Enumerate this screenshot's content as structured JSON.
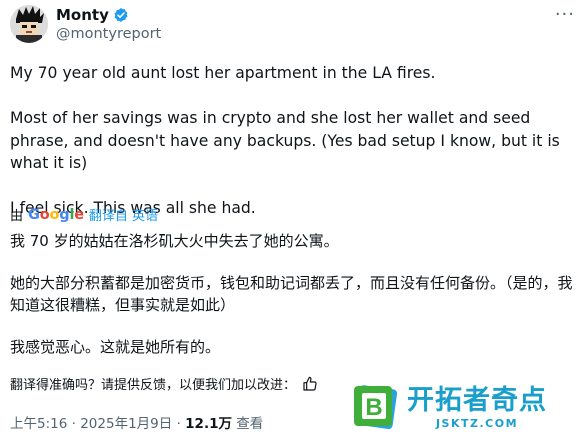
{
  "author": {
    "name": "Monty",
    "handle": "@montyreport",
    "verified": true,
    "avatar_icon": "pixel-art-avatar-icon"
  },
  "more_menu": "···",
  "tweet": {
    "paragraphs": [
      "My 70 year old aunt lost her apartment in the LA fires.",
      "Most of her savings was in crypto and she lost her wallet and seed phrase, and doesn't have any backups. (Yes bad setup I know, but it is what it is)",
      "I feel sick. This was all she had."
    ]
  },
  "translation": {
    "by_label": "由",
    "provider": "Google",
    "link_label": "翻译自 英语",
    "paragraphs": [
      "我 70 岁的姑姑在洛杉矶大火中失去了她的公寓。",
      "她的大部分积蓄都是加密货币，钱包和助记词都丢了，而且没有任何备份。（是的，我知道这很糟糕，但事实就是如此）",
      "我感觉恶心。这就是她所有的。"
    ],
    "feedback_text": "翻译得准确吗？请提供反馈，以便我们加以改进：",
    "feedback_icons": [
      "thumbs-up-icon"
    ]
  },
  "meta": {
    "time": "上午5:16",
    "separator": "·",
    "date": "2025年1月9日",
    "views_count": "12.1万",
    "views_label": "查看"
  },
  "watermark": {
    "title": "开拓者奇点",
    "url": "JSKTZ.COM",
    "logo_letter": "B"
  },
  "colors": {
    "accent": "#1d9bf0",
    "text": "#0f1419",
    "muted": "#536471",
    "watermark": "#1a9fcc"
  }
}
